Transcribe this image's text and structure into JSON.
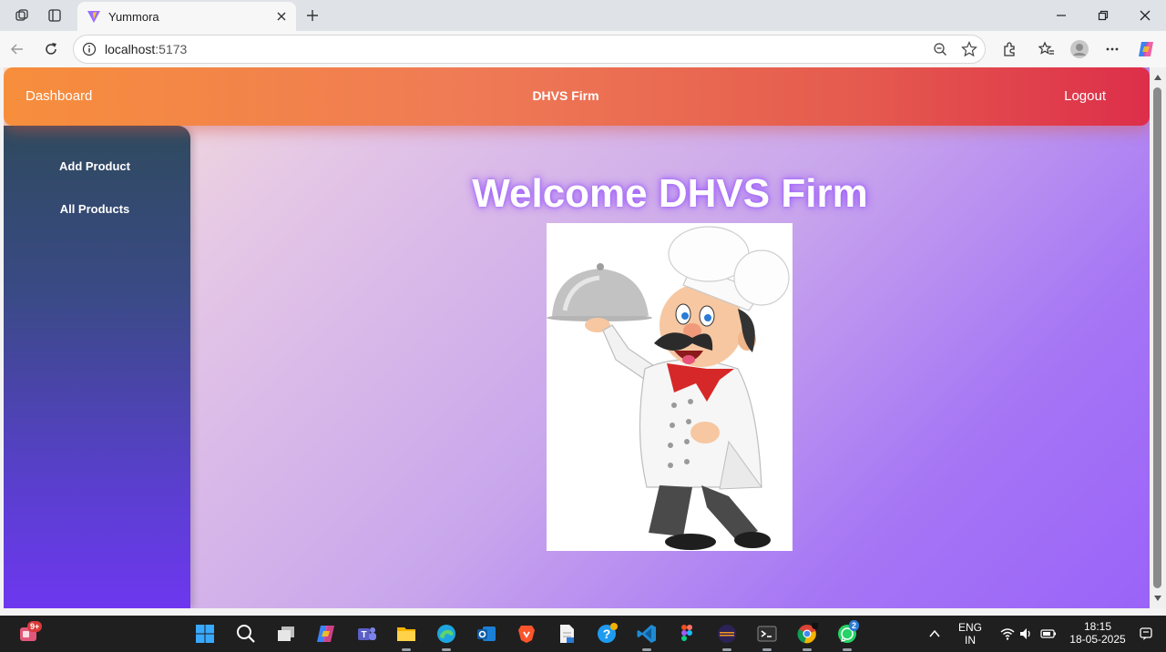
{
  "browser": {
    "tab_title": "Yummora",
    "url_host": "localhost",
    "url_port": ":5173"
  },
  "navbar": {
    "left_link": "Dashboard",
    "brand": "DHVS Firm",
    "right_link": "Logout"
  },
  "sidebar": {
    "items": [
      {
        "label": "Add Product"
      },
      {
        "label": "All Products"
      }
    ]
  },
  "main": {
    "welcome": "Welcome DHVS Firm"
  },
  "taskbar": {
    "notification_badge": "9+",
    "whatsapp_badge": "2",
    "language_line1": "ENG",
    "language_line2": "IN",
    "time": "18:15",
    "date": "18-05-2025"
  },
  "colors": {
    "navbar_start": "#f78e3c",
    "navbar_end": "#dd2e4a",
    "sidebar_top": "#2f4a5e",
    "sidebar_bottom": "#6e37ef",
    "main_bg_end": "#9a63f8"
  }
}
